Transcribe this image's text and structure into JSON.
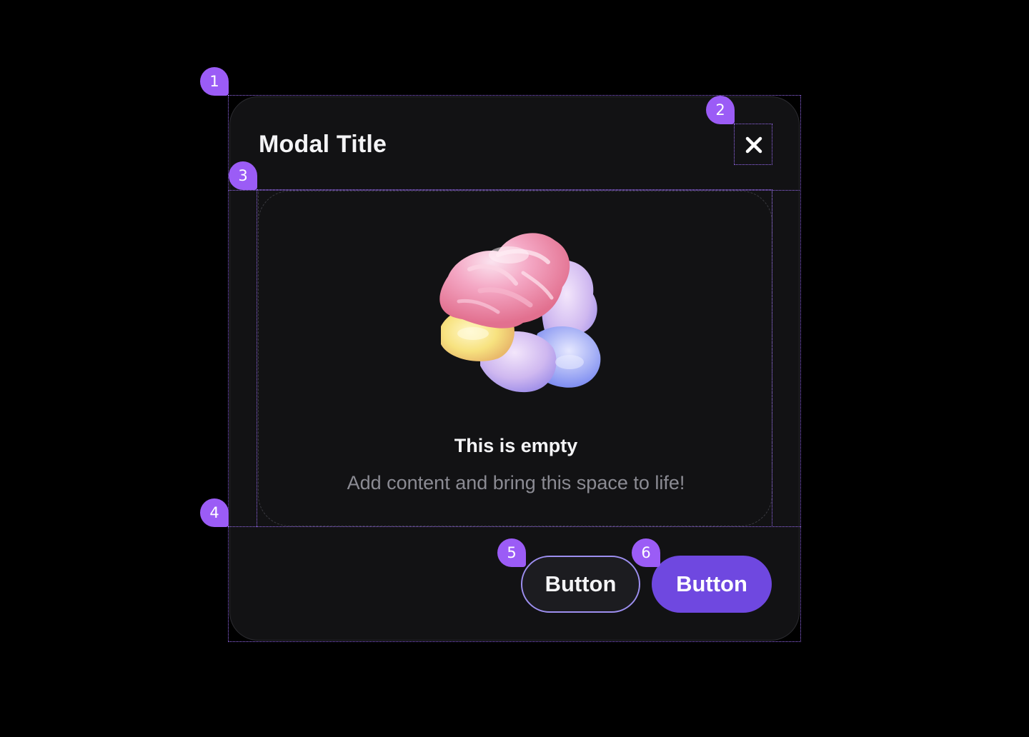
{
  "modal": {
    "title": "Modal Title",
    "close_icon": "close-icon"
  },
  "empty_state": {
    "illustration": "abstract-3d-blob-illustration",
    "title": "This is empty",
    "description": "Add content and bring this space to life!"
  },
  "footer": {
    "secondary_button_label": "Button",
    "primary_button_label": "Button"
  },
  "annotations": {
    "badges": [
      "1",
      "2",
      "3",
      "4",
      "5",
      "6"
    ]
  },
  "colors": {
    "background": "#000000",
    "modal_surface": "#121214",
    "accent_primary": "#6f48e0",
    "secondary_border": "#9d8ff0",
    "annotation": "#9b5cf6",
    "text_primary": "#f4f4f6",
    "text_muted": "#8b8b93"
  }
}
